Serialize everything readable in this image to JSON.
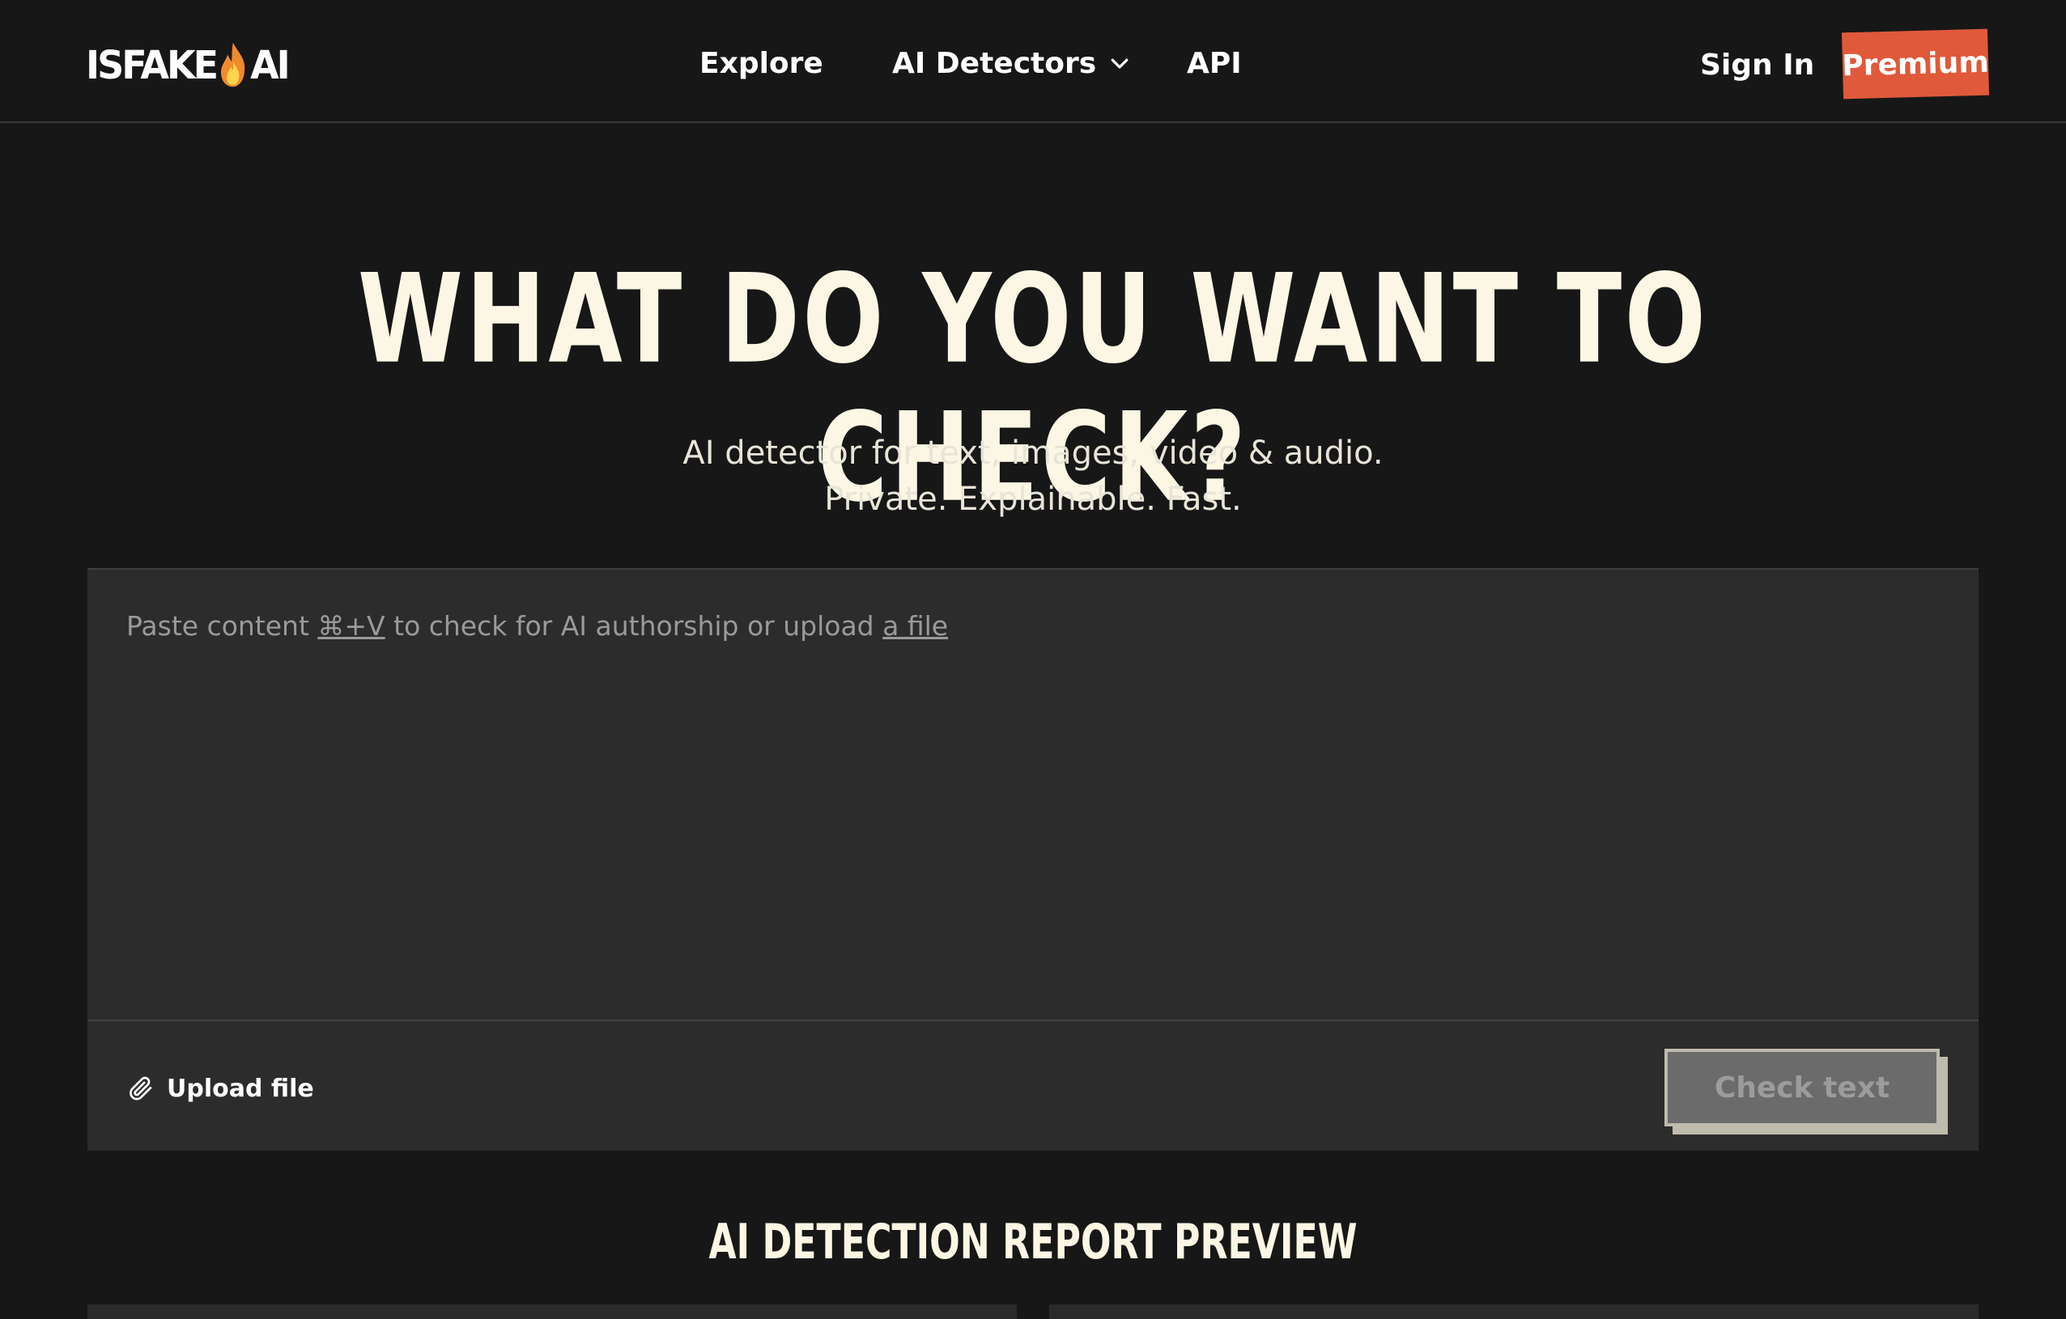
{
  "header": {
    "logo_text_left": "ISFAKE",
    "logo_text_right": "AI",
    "nav": {
      "explore": "Explore",
      "ai_detectors": "AI Detectors",
      "api": "API"
    },
    "sign_in": "Sign In",
    "premium": "Premium"
  },
  "hero": {
    "title": "WHAT DO YOU WANT TO CHECK?",
    "subtitle_line1": "AI detector for text, images, video & audio.",
    "subtitle_line2": "Private. Explainable. Fast."
  },
  "input": {
    "placeholder_prefix": "Paste content ",
    "shortcut": "⌘+V",
    "placeholder_middle": " to check for AI authorship or upload ",
    "file_link": "a file",
    "upload_label": "Upload file",
    "check_label": "Check text"
  },
  "section": {
    "title": "AI DETECTION REPORT PREVIEW"
  },
  "colors": {
    "background": "#171717",
    "panel": "#2c2c2c",
    "accent": "#e0593a",
    "heading": "#fbf7e4"
  }
}
